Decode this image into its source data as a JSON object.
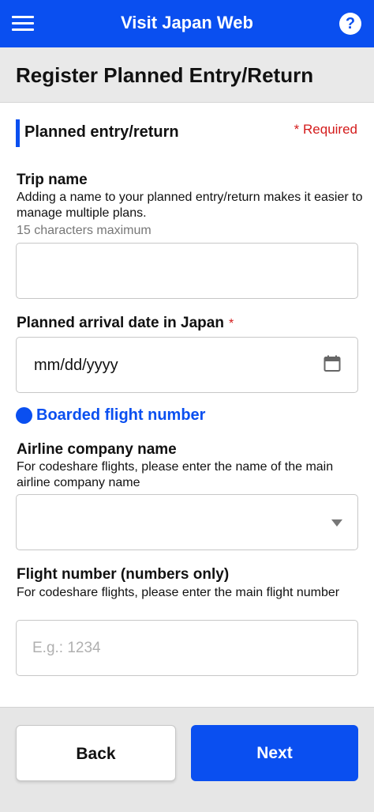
{
  "header": {
    "title": "Visit Japan Web",
    "menu_icon": "hamburger-menu-icon",
    "help_icon": "question-circle-icon",
    "help_glyph": "?",
    "color": "#0a4ff0"
  },
  "page": {
    "title": "Register Planned Entry/Return"
  },
  "section": {
    "title": "Planned entry/return",
    "required_note": "* Required"
  },
  "trip_name": {
    "label": "Trip name",
    "hint": "Adding a name to your planned entry/return makes it easier to manage multiple plans.",
    "limit": "15 characters maximum",
    "value": ""
  },
  "arrival_date": {
    "label": "Planned arrival date in Japan",
    "required_mark": "*",
    "value": "mm/dd/yyyy",
    "icon": "calendar-icon"
  },
  "flight": {
    "heading": "Boarded flight number",
    "airline_label": "Airline company name",
    "airline_hint": "For codeshare flights, please enter the name of the main airline company name",
    "airline_value": "",
    "number_label": "Flight number (numbers only)",
    "number_hint": "For codeshare flights, please enter the main flight number",
    "number_placeholder": "E.g.: 1234"
  },
  "footer": {
    "back_label": "Back",
    "next_label": "Next"
  },
  "colors": {
    "accent": "#0a4ff0",
    "required": "#d41b1b"
  }
}
